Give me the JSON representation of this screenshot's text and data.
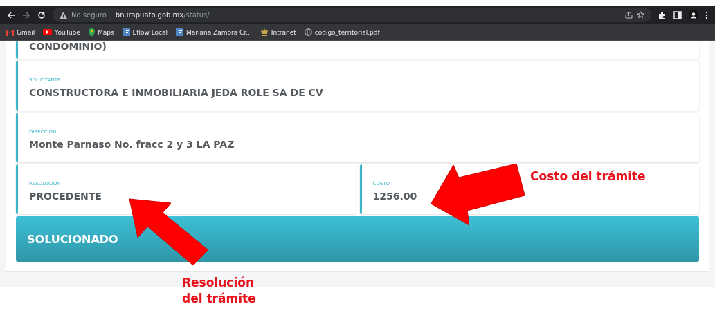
{
  "browser": {
    "security": "No seguro",
    "host": "bn.irapuato.gob.mx",
    "path": "/status/",
    "bookmarks": [
      {
        "label": "Gmail",
        "kind": "gmail"
      },
      {
        "label": "YouTube",
        "kind": "youtube"
      },
      {
        "label": "Maps",
        "kind": "maps"
      },
      {
        "label": "Eflow Local",
        "kind": "eflow"
      },
      {
        "label": "Mariana Zamora Cr...",
        "kind": "eflow"
      },
      {
        "label": "Intranet",
        "kind": "crest"
      },
      {
        "label": "codigo_territorial.pdf",
        "kind": "globe"
      }
    ]
  },
  "cut_value": "CONDOMINIO)",
  "fields": [
    {
      "label": "SOLICITANTE",
      "value": "CONSTRUCTORA E INMOBILIARIA JEDA ROLE SA DE CV"
    },
    {
      "label": "DIRECCION",
      "value": "Monte Parnaso No. fracc 2 y 3 LA PAZ"
    }
  ],
  "pair": [
    {
      "label": "RESOLUCIÓN",
      "value": "PROCEDENTE"
    },
    {
      "label": "COSTO",
      "value": "1256.00"
    }
  ],
  "status": "SOLUCIONADO",
  "annotations": [
    {
      "text": "Costo del trámite",
      "kind": "left"
    },
    {
      "text": "Resolución\ndel trámite",
      "kind": "upleft"
    }
  ]
}
